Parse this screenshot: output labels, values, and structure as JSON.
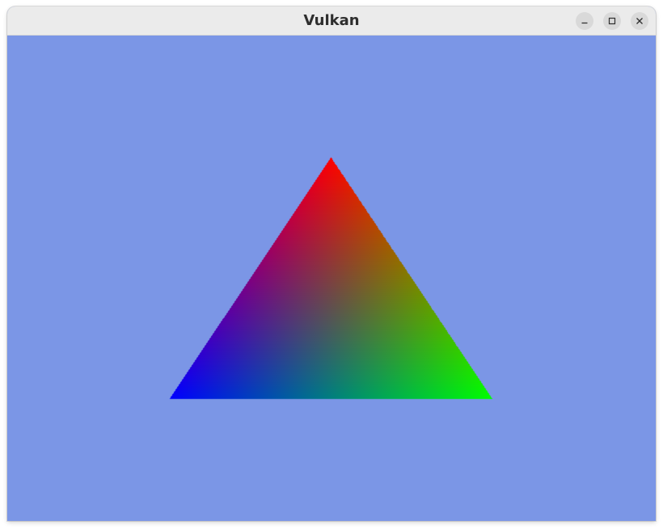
{
  "window": {
    "title": "Vulkan"
  },
  "titlebar_buttons": {
    "minimize_icon": "minimize-icon",
    "maximize_icon": "maximize-icon",
    "close_icon": "close-icon"
  },
  "colors": {
    "clear_color": "#7b96e6",
    "titlebar_bg": "#ebebeb",
    "vertex_top": "#ff0000",
    "vertex_bottom_right": "#00ff00",
    "vertex_bottom_left": "#0000ff"
  }
}
